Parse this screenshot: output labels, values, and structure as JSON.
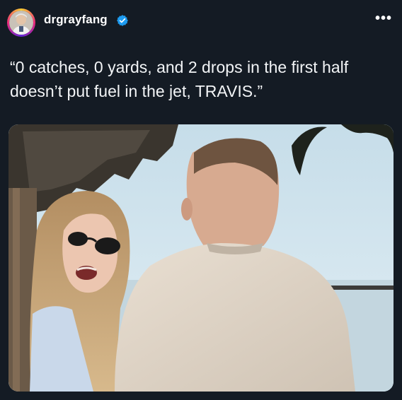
{
  "post": {
    "username": "drgrayfang",
    "verified": true,
    "caption": "“0 catches, 0 yards, and 2 drops in the first half doesn’t put fuel in the jet, TRAVIS.”",
    "image_description_icon": "photo-icon"
  },
  "icons": {
    "verified": "verified-badge-icon",
    "more": "more-options-icon",
    "avatar": "profile-avatar"
  },
  "colors": {
    "background": "#141b24",
    "verified_blue": "#1d9bf0",
    "text": "#f2f4f6"
  }
}
